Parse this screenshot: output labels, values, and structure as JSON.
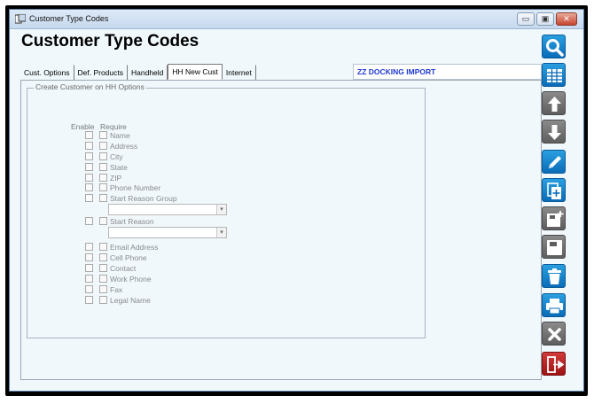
{
  "window": {
    "title": "Customer Type Codes",
    "minimize_glyph": "▭",
    "restore_glyph": "▣",
    "close_glyph": "✕"
  },
  "page": {
    "title": "Customer Type Codes"
  },
  "tabs": [
    {
      "label": "Cust. Options",
      "active": false
    },
    {
      "label": "Def. Products",
      "active": false
    },
    {
      "label": "Handheld",
      "active": false
    },
    {
      "label": "HH New Cust",
      "active": true
    },
    {
      "label": "Internet",
      "active": false
    }
  ],
  "banner": {
    "text": "ZZ  DOCKING IMPORT"
  },
  "group": {
    "legend": "Create Customer on HH Options",
    "enable_header": "Enable",
    "require_header": "Require"
  },
  "fields": {
    "name": "Name",
    "address": "Address",
    "city": "City",
    "state": "State",
    "zip": "ZIP",
    "phone": "Phone Number",
    "start_reason_group": "Start Reason Group",
    "start_reason": "Start Reason",
    "email": "Email Address",
    "cell": "Cell Phone",
    "contact": "Contact",
    "work_phone": "Work Phone",
    "fax": "Fax",
    "legal_name": "Legal Name"
  },
  "dropdown": {
    "arrow_glyph": "▾"
  },
  "toolbar": {
    "icons": [
      "search-icon",
      "grid-icon",
      "arrow-up-icon",
      "arrow-down-icon",
      "edit-icon",
      "copy-icon",
      "new-record-icon",
      "save-icon",
      "delete-icon",
      "print-icon",
      "cancel-icon",
      "exit-icon"
    ]
  },
  "colors": {
    "banner_text": "#1f38d0",
    "toolbar_blue": "#0b6cb8",
    "toolbar_gray": "#5e5e5e",
    "toolbar_red": "#9e1414",
    "window_bg": "#f0f8fc"
  }
}
